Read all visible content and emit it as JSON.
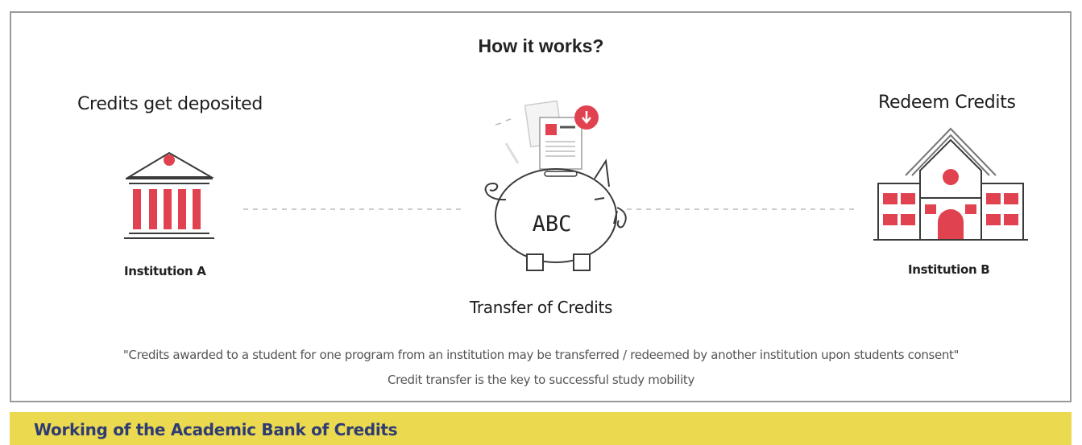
{
  "diagram": {
    "title": "How it works?",
    "left": {
      "heading": "Credits get deposited",
      "caption": "Institution A",
      "icon": "bank-building-icon"
    },
    "center": {
      "caption": "Transfer of Credits",
      "piggy_label": "ABC",
      "icon": "piggy-bank-icon"
    },
    "right": {
      "heading": "Redeem Credits",
      "caption": "Institution B",
      "icon": "school-building-icon"
    },
    "quote": "\"Credits awarded to a student for one program from an institution may be transferred / redeemed by another institution upon students consent\"",
    "tagline": "Credit transfer is the key to successful study mobility"
  },
  "footer": {
    "caption": "Working of the Academic Bank of Credits"
  },
  "colors": {
    "accent_red": "#e0434f",
    "footer_bg": "#ebd94f",
    "footer_text": "#2f3c74",
    "frame_border": "#9a9a9a"
  }
}
